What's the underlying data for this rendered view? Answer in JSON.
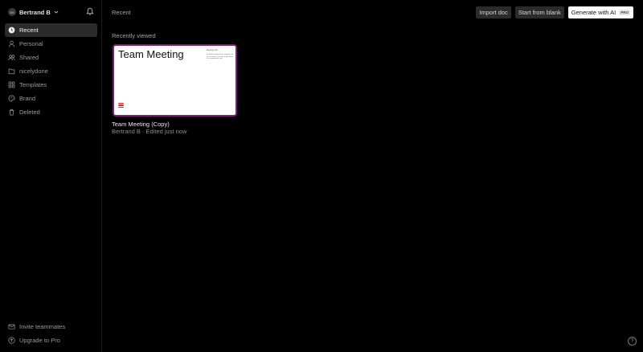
{
  "user": {
    "initials": "BB",
    "name": "Bertrand B"
  },
  "nav": {
    "items": [
      {
        "label": "Recent",
        "icon": "clock-icon",
        "active": true
      },
      {
        "label": "Personal",
        "icon": "person-icon"
      },
      {
        "label": "Shared",
        "icon": "people-icon"
      },
      {
        "label": "nicelydone",
        "icon": "folder-icon"
      },
      {
        "label": "Templates",
        "icon": "grid-icon"
      },
      {
        "label": "Brand",
        "icon": "palette-icon"
      },
      {
        "label": "Deleted",
        "icon": "trash-icon"
      }
    ],
    "bottom": [
      {
        "label": "Invite teammates",
        "icon": "mail-icon"
      },
      {
        "label": "Upgrade to Pro",
        "icon": "upgrade-icon"
      }
    ]
  },
  "header": {
    "breadcrumb": "Recent",
    "import_label": "Import doc",
    "blank_label": "Start from blank",
    "ai_label": "Generate with AI",
    "pro_badge": "PRO"
  },
  "recent": {
    "section_title": "Recently viewed",
    "doc": {
      "thumb_title": "Team Meeting",
      "thumb_meta_title": "Meeting Info",
      "thumb_meta_text": "Default meeting notes template for use in teams, use this to get notes in an organized way.",
      "name": "Team Meeting (Copy)",
      "meta": "Bertrand B · Edited just now"
    }
  },
  "help": {
    "label": "?"
  },
  "colors": {
    "background": "#000000",
    "active_nav": "#2b2b2b",
    "card_border": "#7a1f74",
    "logo": "#e3242b"
  }
}
